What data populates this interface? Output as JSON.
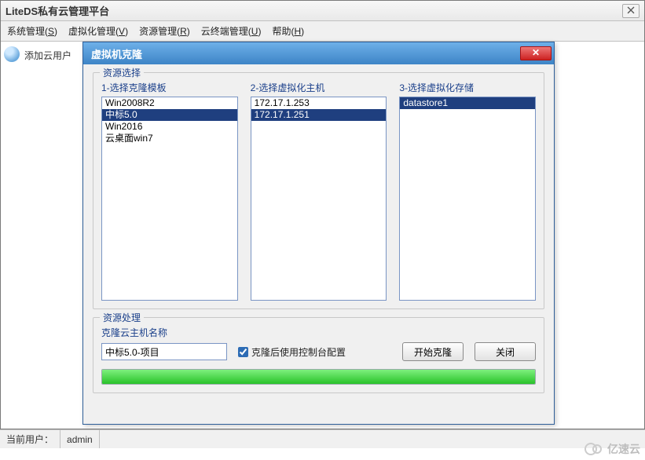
{
  "window": {
    "title": "LiteDS私有云管理平台",
    "sys_close_glyph": "⨉"
  },
  "menu": {
    "items": [
      {
        "label": "系统管理",
        "accel": "S"
      },
      {
        "label": "虚拟化管理",
        "accel": "V"
      },
      {
        "label": "资源管理",
        "accel": "R"
      },
      {
        "label": "云终端管理",
        "accel": "U"
      },
      {
        "label": "帮助",
        "accel": "H"
      }
    ]
  },
  "sidebar": {
    "add_user_label": "添加云用户"
  },
  "dialog": {
    "title": "虚拟机克隆",
    "close_glyph": "✕",
    "resource_select": {
      "legend": "资源选择",
      "col1_label": "1-选择克隆模板",
      "col2_label": "2-选择虚拟化主机",
      "col3_label": "3-选择虚拟化存储",
      "templates": [
        {
          "name": "Win2008R2",
          "selected": false
        },
        {
          "name": "中标5.0",
          "selected": true
        },
        {
          "name": "Win2016",
          "selected": false
        },
        {
          "name": "云桌面win7",
          "selected": false
        }
      ],
      "hosts": [
        {
          "name": "172.17.1.253",
          "selected": false
        },
        {
          "name": "172.17.1.251",
          "selected": true
        }
      ],
      "datastores": [
        {
          "name": "datastore1",
          "selected": true
        }
      ]
    },
    "resource_process": {
      "legend": "资源处理",
      "hostname_label": "克隆云主机名称",
      "hostname_value": "中标5.0-项目",
      "checkbox_label": "克隆后使用控制台配置",
      "checkbox_checked": true,
      "start_button": "开始克隆",
      "close_button": "关闭",
      "progress_percent": 100
    }
  },
  "statusbar": {
    "user_label": "当前用户：",
    "user_value": "admin"
  },
  "watermark": {
    "text": "亿速云"
  }
}
